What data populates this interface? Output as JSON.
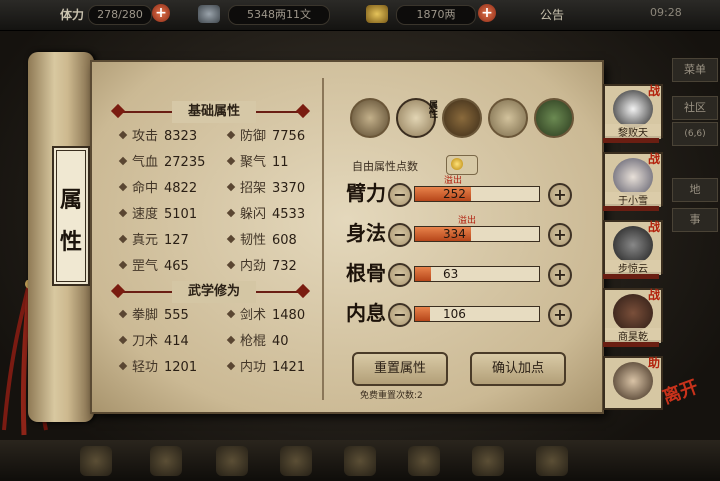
{
  "topbar": {
    "stamina_label": "体力",
    "stamina_value": "278/280",
    "money_value": "5348两11文",
    "gold_value": "1870两",
    "announcement": "公告",
    "time": "09:28"
  },
  "side_menu": [
    "菜单",
    "社区",
    "(6,6)",
    "地",
    "事"
  ],
  "scroll_title": "属性",
  "panel": {
    "basic_title": "基础属性",
    "martial_title": "武学修为",
    "basic_stats": [
      {
        "label": "攻击",
        "value": "8323"
      },
      {
        "label": "防御",
        "value": "7756"
      },
      {
        "label": "气血",
        "value": "27235"
      },
      {
        "label": "聚气",
        "value": "11"
      },
      {
        "label": "命中",
        "value": "4822"
      },
      {
        "label": "招架",
        "value": "3370"
      },
      {
        "label": "速度",
        "value": "5101"
      },
      {
        "label": "躲闪",
        "value": "4533"
      },
      {
        "label": "真元",
        "value": "127"
      },
      {
        "label": "韧性",
        "value": "608"
      },
      {
        "label": "罡气",
        "value": "465"
      },
      {
        "label": "内劲",
        "value": "732"
      }
    ],
    "martial_stats": [
      {
        "label": "拳脚",
        "value": "555"
      },
      {
        "label": "剑术",
        "value": "1480"
      },
      {
        "label": "刀术",
        "value": "414"
      },
      {
        "label": "枪棍",
        "value": "40"
      },
      {
        "label": "轻功",
        "value": "1201"
      },
      {
        "label": "内功",
        "value": "1421"
      }
    ]
  },
  "attr_icons": [
    "head-icon",
    "scroll-icon",
    "bagua-icon",
    "muscle-icon",
    "compass-icon"
  ],
  "attr_icon_selected_label": "属性",
  "free_points_label": "自由属性点数",
  "allocation": [
    {
      "name": "臂力",
      "value": "252",
      "overflow": "溢出",
      "fill": 0.45
    },
    {
      "name": "身法",
      "value": "334",
      "overflow": "溢出",
      "fill": 0.45
    },
    {
      "name": "根骨",
      "value": "63",
      "overflow": "",
      "fill": 0.13
    },
    {
      "name": "内息",
      "value": "106",
      "overflow": "",
      "fill": 0.12
    }
  ],
  "buttons": {
    "reset": "重置属性",
    "confirm": "确认加点",
    "reset_count": "免费重置次数:2"
  },
  "party": [
    {
      "name": "黎败天",
      "tag": "战"
    },
    {
      "name": "于小雪",
      "tag": "战"
    },
    {
      "name": "步惊云",
      "tag": "战"
    },
    {
      "name": "商昊乾",
      "tag": "战"
    },
    {
      "name": "",
      "tag": "助"
    }
  ],
  "leave_label": "离开",
  "colors": {
    "accent": "#7a1c10",
    "bar_fill": "#d0602c",
    "overflow_text": "#b1200e"
  }
}
